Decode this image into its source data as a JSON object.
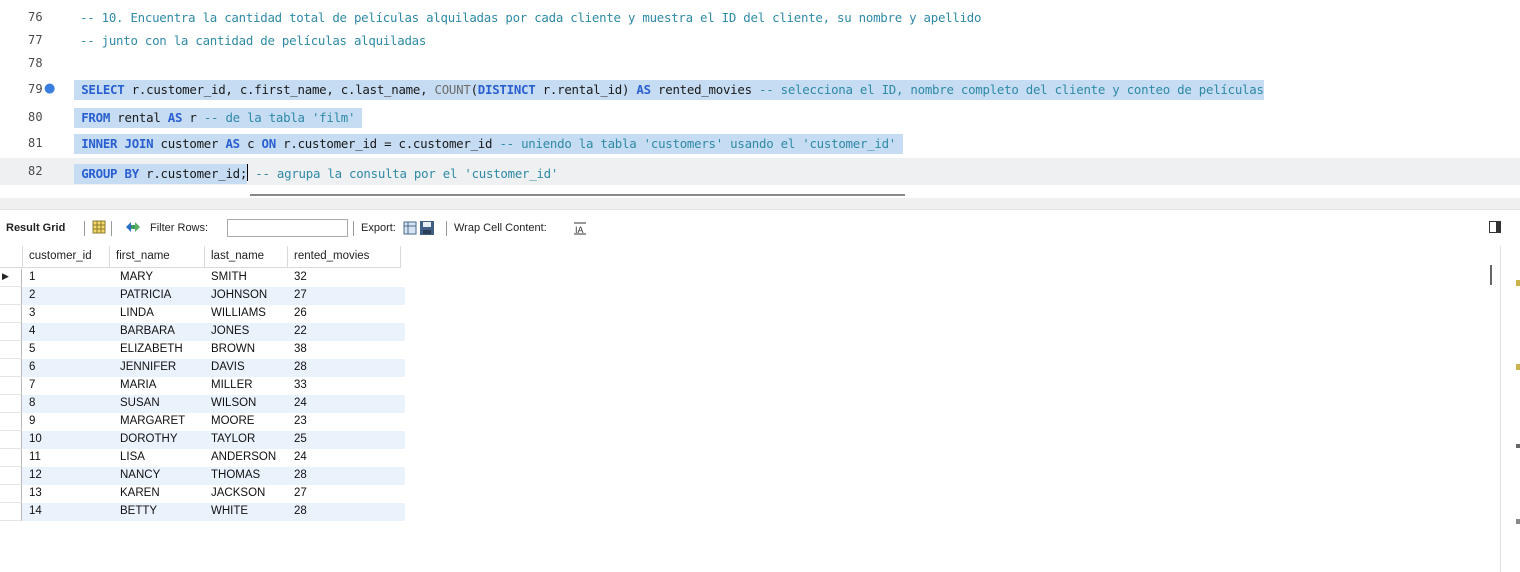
{
  "editor": {
    "lines": [
      {
        "num": "76"
      },
      {
        "num": "77"
      },
      {
        "num": "78"
      },
      {
        "num": "79"
      },
      {
        "num": "80"
      },
      {
        "num": "81"
      },
      {
        "num": "82"
      }
    ],
    "line76": "-- 10. Encuentra la cantidad total de películas alquiladas por cada cliente y muestra el ID del cliente, su nombre y apellido",
    "line77": "-- junto con la cantidad de películas alquiladas",
    "l79": {
      "select_kw": "SELECT",
      "cols": " r.customer_id, c.first_name, c.last_name, ",
      "count_fn": "COUNT",
      "paren_open": "(",
      "distinct_kw": "DISTINCT",
      "rental_id": " r.rental_id) ",
      "as_kw": "AS",
      "alias": " rented_movies ",
      "comment": "-- selecciona el ID, nombre completo del cliente y conteo de películas"
    },
    "l80": {
      "from_kw": "FROM",
      "table": " rental ",
      "as_kw": "AS",
      "alias": " r ",
      "comment": "-- de la tabla 'film'"
    },
    "l81": {
      "inner_kw": "INNER",
      "join_kw": "JOIN",
      "table": " customer ",
      "as_kw": "AS",
      "alias": " c ",
      "on_kw": "ON",
      "cond": " r.customer_id = c.customer_id ",
      "comment": "-- uniendo la tabla 'customers' usando el 'customer_id'"
    },
    "l82": {
      "group_kw": "GROUP",
      "by_kw": "BY",
      "col": " r.customer_id;",
      "comment": " -- agrupa la consulta por el 'customer_id'"
    }
  },
  "toolbar": {
    "result_grid": "Result Grid",
    "filter_rows": "Filter Rows:",
    "export": "Export:",
    "wrap_cell": "Wrap Cell Content:",
    "filter_value": ""
  },
  "grid": {
    "columns": [
      "customer_id",
      "first_name",
      "last_name",
      "rented_movies"
    ],
    "rows": [
      [
        "1",
        "MARY",
        "SMITH",
        "32"
      ],
      [
        "2",
        "PATRICIA",
        "JOHNSON",
        "27"
      ],
      [
        "3",
        "LINDA",
        "WILLIAMS",
        "26"
      ],
      [
        "4",
        "BARBARA",
        "JONES",
        "22"
      ],
      [
        "5",
        "ELIZABETH",
        "BROWN",
        "38"
      ],
      [
        "6",
        "JENNIFER",
        "DAVIS",
        "28"
      ],
      [
        "7",
        "MARIA",
        "MILLER",
        "33"
      ],
      [
        "8",
        "SUSAN",
        "WILSON",
        "24"
      ],
      [
        "9",
        "MARGARET",
        "MOORE",
        "23"
      ],
      [
        "10",
        "DOROTHY",
        "TAYLOR",
        "25"
      ],
      [
        "11",
        "LISA",
        "ANDERSON",
        "24"
      ],
      [
        "12",
        "NANCY",
        "THOMAS",
        "28"
      ],
      [
        "13",
        "KAREN",
        "JACKSON",
        "27"
      ],
      [
        "14",
        "BETTY",
        "WHITE",
        "28"
      ]
    ]
  },
  "icons": {
    "grid_view": "grid-icon",
    "filter": "filter-arrows-icon",
    "export": "save-disk-icon",
    "wrap": "wrap-text-icon",
    "panel": "panel-toggle-icon",
    "current_row": "row-pointer-icon",
    "breakpoint": "statement-dot-icon"
  },
  "colors": {
    "selection": "#c5dcf3",
    "keyword": "#2a5fd0",
    "comment": "#2f8aa6",
    "alt_row": "#eaf3fc"
  }
}
